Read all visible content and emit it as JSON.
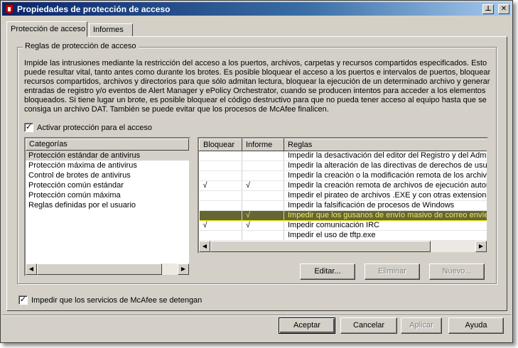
{
  "window": {
    "title": "Propiedades de protección de acceso",
    "icon": "shield-icon",
    "pin_icon": "pin-icon",
    "close_icon": "close-icon"
  },
  "tabs": [
    {
      "label": "Protección de acceso",
      "active": true
    },
    {
      "label": "Informes",
      "active": false
    }
  ],
  "rules_group": {
    "label": "Reglas de protección de acceso",
    "description": "Impide las intrusiones mediante la restricción del acceso a los puertos, archivos, carpetas y recursos compartidos especificados. Esto\npuede resultar vital, tanto antes como durante los brotes. Es posible bloquear el acceso a los puertos e intervalos de puertos, bloquear\nrecursos compartidos, archivos y directorios para que sólo admitan lectura, bloquear la ejecución de un determinado archivo y generar\nentradas de registro y/o eventos de Alert Manager y ePolicy Orchestrator, cuando se producen intentos para acceder a los elementos\nbloqueados. Si tiene lugar un brote, es posible bloquear el código destructivo para que no pueda tener acceso al equipo hasta que se\nconsiga un archivo DAT. También se puede evitar que los procesos de McAfee finalicen.",
    "enable_checkbox": {
      "label": "Activar protección para el acceso",
      "checked": true
    }
  },
  "categories": {
    "header": "Categorías",
    "items": [
      {
        "label": "Protección estándar de antivirus",
        "selected": true
      },
      {
        "label": "Protección máxima de antivirus",
        "selected": false
      },
      {
        "label": "Control de brotes de antivirus",
        "selected": false
      },
      {
        "label": "Protección común estándar",
        "selected": false
      },
      {
        "label": "Protección común máxima",
        "selected": false
      },
      {
        "label": "Reglas definidas por el usuario",
        "selected": false
      }
    ]
  },
  "rules_table": {
    "columns": [
      "Bloquear",
      "Informe",
      "Reglas"
    ],
    "rows": [
      {
        "block": "",
        "report": "",
        "rule": "Impedir la desactivación del editor del Registro y del Admini",
        "highlight": false
      },
      {
        "block": "",
        "report": "",
        "rule": "Impedir la alteración de las directivas de derechos de usuar",
        "highlight": false
      },
      {
        "block": "",
        "report": "",
        "rule": "Impedir la creación o la modificación remota de los archivos",
        "highlight": false
      },
      {
        "block": "√",
        "report": "√",
        "rule": "Impedir la creación remota de archivos de ejecución autom",
        "highlight": false
      },
      {
        "block": "",
        "report": "",
        "rule": "Impedir el pirateo de archivos .EXE y con otras extensiones",
        "highlight": false
      },
      {
        "block": "",
        "report": "",
        "rule": "Impedir la falsificación de procesos de Windows",
        "highlight": false
      },
      {
        "block": "",
        "report": "√",
        "rule": "Impedir que los gusanos de envío masivo de correo envíen",
        "highlight": true
      },
      {
        "block": "√",
        "report": "√",
        "rule": "Impedir comunicación IRC",
        "highlight": false
      },
      {
        "block": "",
        "report": "",
        "rule": "Impedir el uso de tftp.exe",
        "highlight": false
      }
    ],
    "scroll_left_icon": "arrow-left-icon",
    "scroll_right_icon": "arrow-right-icon"
  },
  "rule_buttons": {
    "edit": "Editar...",
    "delete": "Eliminar",
    "new": "Nuevo..."
  },
  "stop_checkbox": {
    "label": "Impedir que los servicios de McAfee se detengan",
    "checked": true
  },
  "dialog_buttons": {
    "ok": "Aceptar",
    "cancel": "Cancelar",
    "apply": "Aplicar",
    "help": "Ayuda"
  }
}
